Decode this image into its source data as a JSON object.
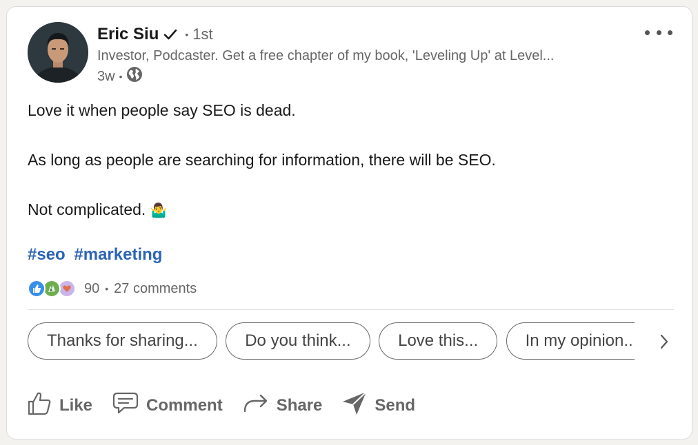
{
  "post": {
    "author": {
      "name": "Eric Siu",
      "degree": "1st",
      "headline": "Investor, Podcaster. Get a free chapter of my book, 'Leveling Up' at Level...",
      "time": "3w"
    },
    "body": {
      "line1": "Love it when people say SEO is dead.",
      "line2": "As long as people are searching for information, there will be SEO.",
      "line3": "Not complicated.",
      "emoji": "🤷‍♂️"
    },
    "hashtags": [
      "#seo",
      "#marketing"
    ],
    "reactions": {
      "count": "90",
      "comments": "27 comments"
    }
  },
  "suggestions": [
    "Thanks for sharing...",
    "Do you think...",
    "Love this...",
    "In my opinion..."
  ],
  "actions": {
    "like": "Like",
    "comment": "Comment",
    "share": "Share",
    "send": "Send"
  },
  "colors": {
    "hashtag": "#2a64b6",
    "like_reaction": "#378fe9",
    "celebrate_reaction": "#44712e",
    "love_reaction": "#df704d"
  },
  "icons": {
    "verified": "checkmark-icon",
    "visibility": "globe-icon",
    "menu": "more-options-icon",
    "next": "chevron-right-icon"
  }
}
